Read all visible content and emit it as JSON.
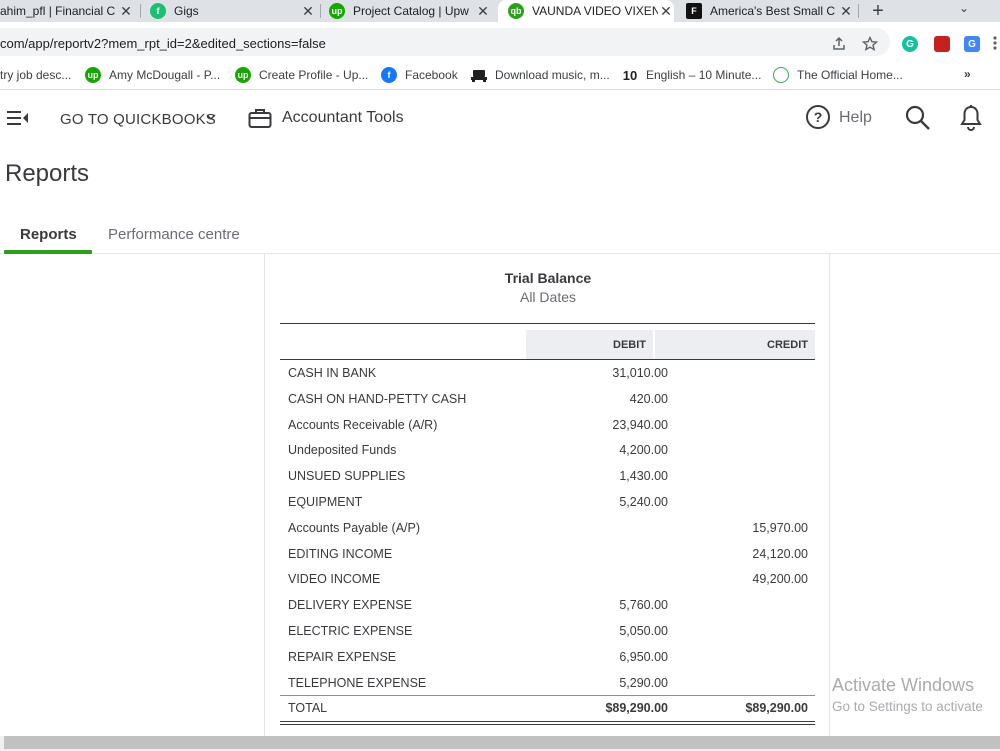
{
  "browser": {
    "tabs": [
      {
        "title": "ahim_pfl | Financial C",
        "favicon": "fiverr-profile-icon",
        "active": false
      },
      {
        "title": "Gigs",
        "favicon": "fiverr-icon",
        "active": false
      },
      {
        "title": "Project Catalog | Upw",
        "favicon": "upwork-icon",
        "active": false
      },
      {
        "title": "VAUNDA VIDEO VIXEN",
        "favicon": "quickbooks-icon",
        "active": true
      },
      {
        "title": "America's Best Small C",
        "favicon": "forbes-icon",
        "active": false
      }
    ],
    "close_glyph": "✕",
    "new_tab_glyph": "+",
    "tab_menu_glyph": "⌄",
    "url": "com/app/reportv2?mem_rpt_id=2&edited_sections=false",
    "bookmarks": [
      {
        "label": "try job desc...",
        "icon": ""
      },
      {
        "label": "Amy McDougall - P...",
        "icon": "upwork-icon"
      },
      {
        "label": "Create Profile - Up...",
        "icon": "upwork-icon"
      },
      {
        "label": "Facebook",
        "icon": "facebook-icon"
      },
      {
        "label": "Download music, m...",
        "icon": "music-icon"
      },
      {
        "label": "English – 10 Minute...",
        "icon": "ten-minute-icon"
      },
      {
        "label": "The Official Home...",
        "icon": "official-home-icon"
      }
    ],
    "bookmarks_more": "»",
    "favicon_glyphs": {
      "fiverr": "f",
      "upwork": "up",
      "quickbooks": "qb",
      "forbes": "F",
      "facebook": "f",
      "ten": "10"
    }
  },
  "app": {
    "menu_label": "GO TO QUICKBOOKS",
    "accountant_tools": "Accountant Tools",
    "help_label": "Help",
    "help_glyph": "?"
  },
  "page": {
    "title": "Reports",
    "tabs": [
      {
        "label": "Reports",
        "active": true
      },
      {
        "label": "Performance centre",
        "active": false
      }
    ]
  },
  "report": {
    "title": "Trial Balance",
    "subtitle": "All Dates",
    "columns": {
      "debit": "DEBIT",
      "credit": "CREDIT"
    },
    "rows": [
      {
        "account": "CASH IN BANK",
        "debit": "31,010.00",
        "credit": ""
      },
      {
        "account": "CASH ON HAND-PETTY CASH",
        "debit": "420.00",
        "credit": ""
      },
      {
        "account": "Accounts Receivable (A/R)",
        "debit": "23,940.00",
        "credit": ""
      },
      {
        "account": "Undeposited Funds",
        "debit": "4,200.00",
        "credit": ""
      },
      {
        "account": "UNSUED SUPPLIES",
        "debit": "1,430.00",
        "credit": ""
      },
      {
        "account": "EQUIPMENT",
        "debit": "5,240.00",
        "credit": ""
      },
      {
        "account": "Accounts Payable (A/P)",
        "debit": "",
        "credit": "15,970.00"
      },
      {
        "account": "EDITING INCOME",
        "debit": "",
        "credit": "24,120.00"
      },
      {
        "account": "VIDEO INCOME",
        "debit": "",
        "credit": "49,200.00"
      },
      {
        "account": "DELIVERY EXPENSE",
        "debit": "5,760.00",
        "credit": ""
      },
      {
        "account": "ELECTRIC EXPENSE",
        "debit": "5,050.00",
        "credit": ""
      },
      {
        "account": "REPAIR EXPENSE",
        "debit": "6,950.00",
        "credit": ""
      },
      {
        "account": "TELEPHONE EXPENSE",
        "debit": "5,290.00",
        "credit": ""
      }
    ],
    "total": {
      "label": "TOTAL",
      "debit": "$89,290.00",
      "credit": "$89,290.00"
    }
  },
  "watermark": {
    "line1": "Activate Windows",
    "line2": "Go to Settings to activate"
  },
  "colors": {
    "accent_green": "#2ca01c",
    "text": "#393a3d",
    "header_bg": "#eceef1",
    "tabstrip_bg": "#dee1e6"
  }
}
